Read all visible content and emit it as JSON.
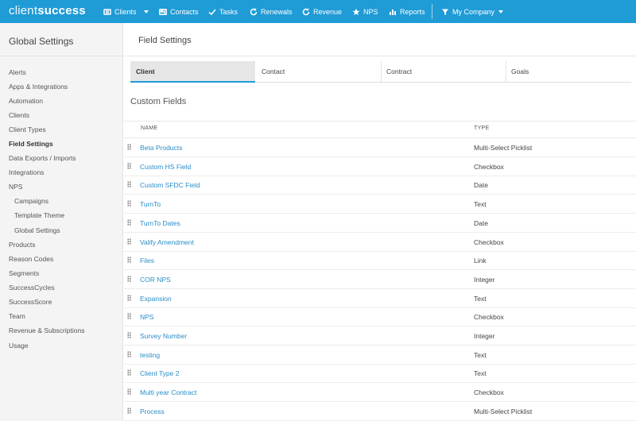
{
  "app": {
    "logo_part1": "client",
    "logo_part2": "success"
  },
  "topnav": {
    "items": [
      {
        "label": "Clients",
        "icon": "clients-icon"
      },
      {
        "label": "Contacts",
        "icon": "contacts-icon"
      },
      {
        "label": "Tasks",
        "icon": "check-icon"
      },
      {
        "label": "Renewals",
        "icon": "refresh-icon"
      },
      {
        "label": "Revenue",
        "icon": "refresh-icon"
      },
      {
        "label": "NPS",
        "icon": "star-icon"
      },
      {
        "label": "Reports",
        "icon": "bar-chart-icon"
      }
    ],
    "company": {
      "label": "My Company",
      "icon": "filter-icon"
    }
  },
  "sidebar": {
    "title": "Global Settings",
    "items": [
      {
        "label": "Alerts"
      },
      {
        "label": "Apps & Integrations"
      },
      {
        "label": "Automation"
      },
      {
        "label": "Clients"
      },
      {
        "label": "Client Types"
      },
      {
        "label": "Field Settings",
        "active": true
      },
      {
        "label": "Data Exports / Imports"
      },
      {
        "label": "Integrations"
      },
      {
        "label": "NPS"
      },
      {
        "label": "Campaigns",
        "sub": true
      },
      {
        "label": "Template Theme",
        "sub": true
      },
      {
        "label": "Global Settings",
        "sub": true
      },
      {
        "label": "Products"
      },
      {
        "label": "Reason Codes"
      },
      {
        "label": "Segments"
      },
      {
        "label": "SuccessCycles"
      },
      {
        "label": "SuccessScore"
      },
      {
        "label": "Team"
      },
      {
        "label": "Revenue & Subscriptions"
      },
      {
        "label": "Usage"
      }
    ]
  },
  "main": {
    "title": "Field Settings",
    "tabs": [
      {
        "label": "Client",
        "active": true
      },
      {
        "label": "Contact"
      },
      {
        "label": "Contract"
      },
      {
        "label": "Goals"
      }
    ],
    "section_title": "Custom Fields",
    "columns": {
      "name": "NAME",
      "type": "TYPE"
    },
    "rows": [
      {
        "name": "Beta Products",
        "type": "Multi-Select Picklist"
      },
      {
        "name": "Custom HS Field",
        "type": "Checkbox"
      },
      {
        "name": "Custom SFDC Field",
        "type": "Date"
      },
      {
        "name": "TurnTo",
        "type": "Text"
      },
      {
        "name": "TurnTo Dates",
        "type": "Date"
      },
      {
        "name": "Valify Amendment",
        "type": "Checkbox"
      },
      {
        "name": "Files",
        "type": "Link"
      },
      {
        "name": "COR NPS",
        "type": "Integer"
      },
      {
        "name": "Expansion",
        "type": "Text"
      },
      {
        "name": "NPS",
        "type": "Checkbox"
      },
      {
        "name": "Survey Number",
        "type": "Integer"
      },
      {
        "name": "testing",
        "type": "Text"
      },
      {
        "name": "Client Type 2",
        "type": "Text"
      },
      {
        "name": "Multi year Contract",
        "type": "Checkbox"
      },
      {
        "name": "Process",
        "type": "Multi-Select Picklist"
      }
    ]
  }
}
